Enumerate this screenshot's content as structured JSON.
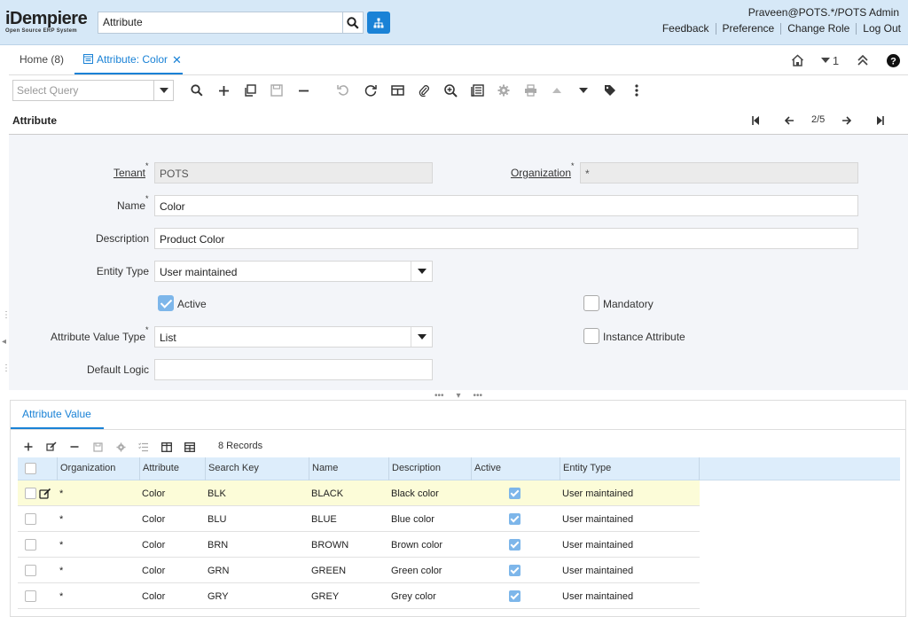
{
  "header": {
    "logo_main": "iDempiere",
    "logo_sub": "Open Source ERP System",
    "search_value": "Attribute",
    "user": "Praveen@POTS.*/POTS Admin",
    "links": [
      "Feedback",
      "Preference",
      "Change Role",
      "Log Out"
    ]
  },
  "tabs": {
    "home": "Home (8)",
    "active": "Attribute: Color",
    "badge_count": "1"
  },
  "toolbar": {
    "query_placeholder": "Select Query"
  },
  "title": {
    "text": "Attribute",
    "record_pos": "2/5"
  },
  "form": {
    "tenant_label": "Tenant",
    "tenant_value": "POTS",
    "org_label": "Organization",
    "org_value": "*",
    "name_label": "Name",
    "name_value": "Color",
    "desc_label": "Description",
    "desc_value": "Product Color",
    "entity_label": "Entity Type",
    "entity_value": "User maintained",
    "active_label": "Active",
    "active_checked": true,
    "mandatory_label": "Mandatory",
    "mandatory_checked": false,
    "value_type_label": "Attribute Value Type",
    "value_type_value": "List",
    "instance_label": "Instance Attribute",
    "instance_checked": false,
    "default_logic_label": "Default Logic",
    "default_logic_value": ""
  },
  "subtab": {
    "label": "Attribute Value",
    "records": "8 Records",
    "columns": [
      "Organization",
      "Attribute",
      "Search Key",
      "Name",
      "Description",
      "Active",
      "Entity Type"
    ],
    "rows": [
      {
        "org": "*",
        "attr": "Color",
        "key": "BLK",
        "name": "BLACK",
        "desc": "Black color",
        "active": true,
        "entity": "User maintained"
      },
      {
        "org": "*",
        "attr": "Color",
        "key": "BLU",
        "name": "BLUE",
        "desc": "Blue color",
        "active": true,
        "entity": "User maintained"
      },
      {
        "org": "*",
        "attr": "Color",
        "key": "BRN",
        "name": "BROWN",
        "desc": "Brown color",
        "active": true,
        "entity": "User maintained"
      },
      {
        "org": "*",
        "attr": "Color",
        "key": "GRN",
        "name": "GREEN",
        "desc": "Green color",
        "active": true,
        "entity": "User maintained"
      },
      {
        "org": "*",
        "attr": "Color",
        "key": "GRY",
        "name": "GREY",
        "desc": "Grey color",
        "active": true,
        "entity": "User maintained"
      }
    ]
  },
  "colors": {
    "accent": "#1a82d6",
    "header_bg": "#d6e8f7",
    "selected_row": "#fcfcd8"
  }
}
